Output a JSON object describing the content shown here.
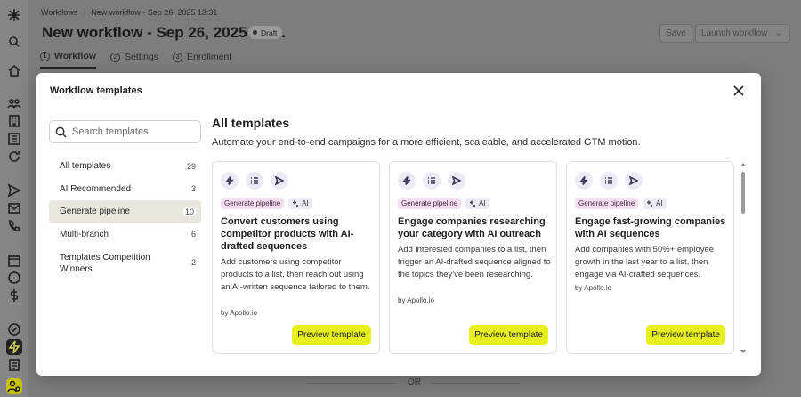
{
  "header": {
    "breadcrumb_root": "Workflows",
    "breadcrumb_current": "New workflow - Sep 26, 2025 13:31",
    "title": "New workflow - Sep 26, 2025 13:...",
    "status": "Draft",
    "save_label": "Save",
    "launch_label": "Launch workflow",
    "tabs": [
      {
        "num": "1",
        "label": "Workflow"
      },
      {
        "num": "2",
        "label": "Settings"
      },
      {
        "num": "3",
        "label": "Enrollment"
      }
    ]
  },
  "footer": {
    "or_label": "OR"
  },
  "modal": {
    "title": "Workflow templates",
    "search_placeholder": "Search templates",
    "categories": [
      {
        "label": "All templates",
        "count": "29"
      },
      {
        "label": "AI Recommended",
        "count": "3"
      },
      {
        "label": "Generate pipeline",
        "count": "10"
      },
      {
        "label": "Multi-branch",
        "count": "6"
      },
      {
        "label": "Templates Competition Winners",
        "count": "2"
      }
    ],
    "section_title": "All templates",
    "section_desc": "Automate your end-to-end campaigns for a more efficient, scaleable, and accelerated GTM motion.",
    "cards": [
      {
        "tag1": "Generate pipeline",
        "tag2": "AI",
        "title": "Convert customers using competitor products with AI-drafted sequences",
        "desc": "Add customers using competitor products to a list, then reach out using an AI-written sequence tailored to them.",
        "by": "by Apollo.io",
        "button": "Preview template"
      },
      {
        "tag1": "Generate pipeline",
        "tag2": "AI",
        "title": "Engage companies researching your category with AI outreach",
        "desc": "Add interested companies to a list, then trigger an AI-drafted sequence aligned to the topics they've been researching.",
        "by": "by Apollo.io",
        "button": "Preview template"
      },
      {
        "tag1": "Generate pipeline",
        "tag2": "AI",
        "title": "Engage fast-growing companies with AI sequences",
        "desc": "Add companies with 50%+ employee growth in the last year to a list, then engage via AI-crafted sequences.",
        "by": "by Apollo.io",
        "button": "Preview template"
      }
    ]
  },
  "colors": {
    "accent": "#e7f01d",
    "tag_pink": "#f6ddf0",
    "selected_bg": "#e9e6de"
  },
  "icons": [
    "logo-asterisk-icon",
    "search-icon",
    "home-icon",
    "people-icon",
    "building-icon",
    "list-icon",
    "refresh-icon",
    "send-icon",
    "mail-icon",
    "phone-icon",
    "calendar-icon",
    "chat-icon",
    "dollar-icon",
    "check-circle-icon",
    "bolt-icon",
    "doc-icon",
    "user-settings-icon"
  ]
}
